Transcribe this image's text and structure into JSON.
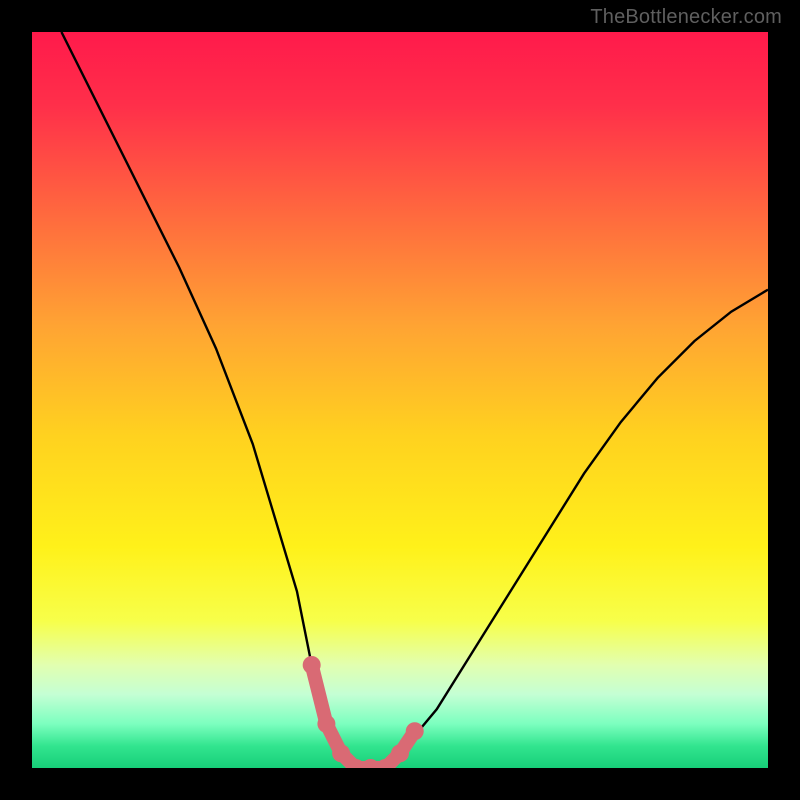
{
  "watermark": "TheBottlenecker.com",
  "chart_data": {
    "type": "line",
    "title": "",
    "xlabel": "",
    "ylabel": "",
    "xlim": [
      0,
      100
    ],
    "ylim": [
      0,
      100
    ],
    "series": [
      {
        "name": "bottleneck-curve",
        "x": [
          4,
          10,
          15,
          20,
          25,
          30,
          33,
          36,
          38,
          40,
          42,
          44,
          46,
          48,
          50,
          55,
          60,
          65,
          70,
          75,
          80,
          85,
          90,
          95,
          100
        ],
        "values": [
          100,
          88,
          78,
          68,
          57,
          44,
          34,
          24,
          14,
          6,
          2,
          0,
          0,
          0,
          2,
          8,
          16,
          24,
          32,
          40,
          47,
          53,
          58,
          62,
          65
        ],
        "color": "#000000"
      },
      {
        "name": "curve-highlight-dots",
        "x": [
          38,
          40,
          42,
          44,
          46,
          48,
          50,
          52
        ],
        "values": [
          14,
          6,
          2,
          0,
          0,
          0,
          2,
          5
        ],
        "color": "#d96a74"
      }
    ],
    "background_gradient": {
      "stops": [
        {
          "offset": 0.0,
          "color": "#ff1a4b"
        },
        {
          "offset": 0.1,
          "color": "#ff2f4a"
        },
        {
          "offset": 0.25,
          "color": "#ff6a3e"
        },
        {
          "offset": 0.4,
          "color": "#ffa433"
        },
        {
          "offset": 0.55,
          "color": "#ffd21f"
        },
        {
          "offset": 0.7,
          "color": "#fff11a"
        },
        {
          "offset": 0.8,
          "color": "#f7ff4a"
        },
        {
          "offset": 0.86,
          "color": "#e2ffb0"
        },
        {
          "offset": 0.9,
          "color": "#c4ffd4"
        },
        {
          "offset": 0.94,
          "color": "#7cffbf"
        },
        {
          "offset": 0.97,
          "color": "#32e58f"
        },
        {
          "offset": 1.0,
          "color": "#17cf79"
        }
      ]
    }
  }
}
